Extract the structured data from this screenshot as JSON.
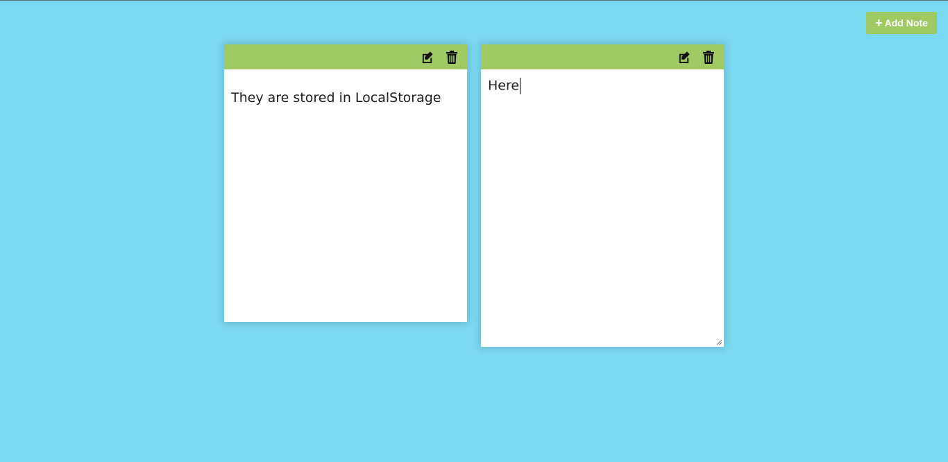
{
  "toolbar": {
    "add_note_label": "Add Note",
    "add_icon": "plus-icon"
  },
  "notes": [
    {
      "text": "They are stored in LocalStorage",
      "mode": "view",
      "edit_icon": "edit-icon",
      "delete_icon": "trash-icon"
    },
    {
      "text": "Here",
      "mode": "edit",
      "edit_icon": "edit-icon",
      "delete_icon": "trash-icon"
    }
  ],
  "colors": {
    "background": "#7bd9f1",
    "accent": "#9ec963",
    "note": "#ffffff"
  }
}
